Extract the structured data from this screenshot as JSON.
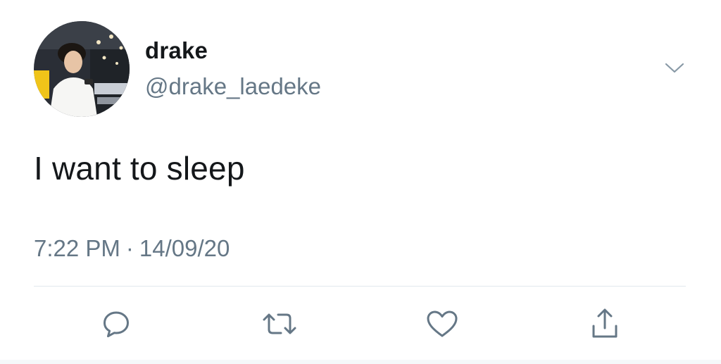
{
  "tweet": {
    "display_name": "drake",
    "handle": "@drake_laedeke",
    "text": "I want to sleep",
    "time": "7:22 PM",
    "separator": "·",
    "date": "14/09/20"
  },
  "icons": {
    "menu": "chevron-down-icon",
    "reply": "reply-bubble-icon",
    "retweet": "retweet-icon",
    "like": "heart-icon",
    "share": "share-icon"
  },
  "colors": {
    "text_primary": "#14171a",
    "text_secondary": "#657786",
    "icon": "#657786",
    "divider": "#e1e8ed"
  }
}
